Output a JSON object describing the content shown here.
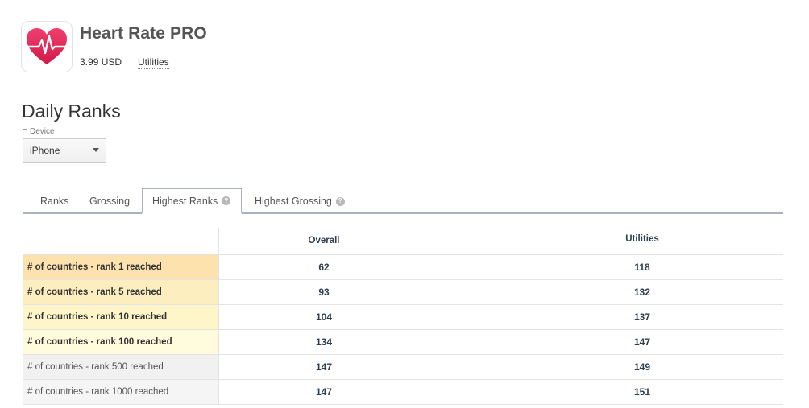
{
  "app": {
    "title": "Heart Rate PRO",
    "price": "3.99 USD",
    "category": "Utilities",
    "icon": "heart-rate-app-icon",
    "icon_color": "#e0245e"
  },
  "section": {
    "title": "Daily Ranks",
    "device_label": "Device",
    "device_value": "iPhone"
  },
  "tabs": [
    {
      "label": "Ranks",
      "active": false,
      "help": false
    },
    {
      "label": "Grossing",
      "active": false,
      "help": false
    },
    {
      "label": "Highest Ranks",
      "active": true,
      "help": true
    },
    {
      "label": "Highest Grossing",
      "active": false,
      "help": true
    }
  ],
  "table": {
    "columns": [
      "Overall",
      "Utilities"
    ],
    "rows": [
      {
        "label": "# of countries - rank 1 reached",
        "overall": "62",
        "category": "118",
        "highlight": "#fde2ad"
      },
      {
        "label": "# of countries - rank 5 reached",
        "overall": "93",
        "category": "132",
        "highlight": "#fdeebf"
      },
      {
        "label": "# of countries - rank 10 reached",
        "overall": "104",
        "category": "137",
        "highlight": "#fef5c9"
      },
      {
        "label": "# of countries - rank 100 reached",
        "overall": "134",
        "category": "147",
        "highlight": "#fffbdc"
      },
      {
        "label": "# of countries - rank 500 reached",
        "overall": "147",
        "category": "149",
        "highlight": "#f1f1f1"
      },
      {
        "label": "# of countries - rank 1000 reached",
        "overall": "147",
        "category": "151",
        "highlight": "#f5f5f5"
      }
    ]
  }
}
